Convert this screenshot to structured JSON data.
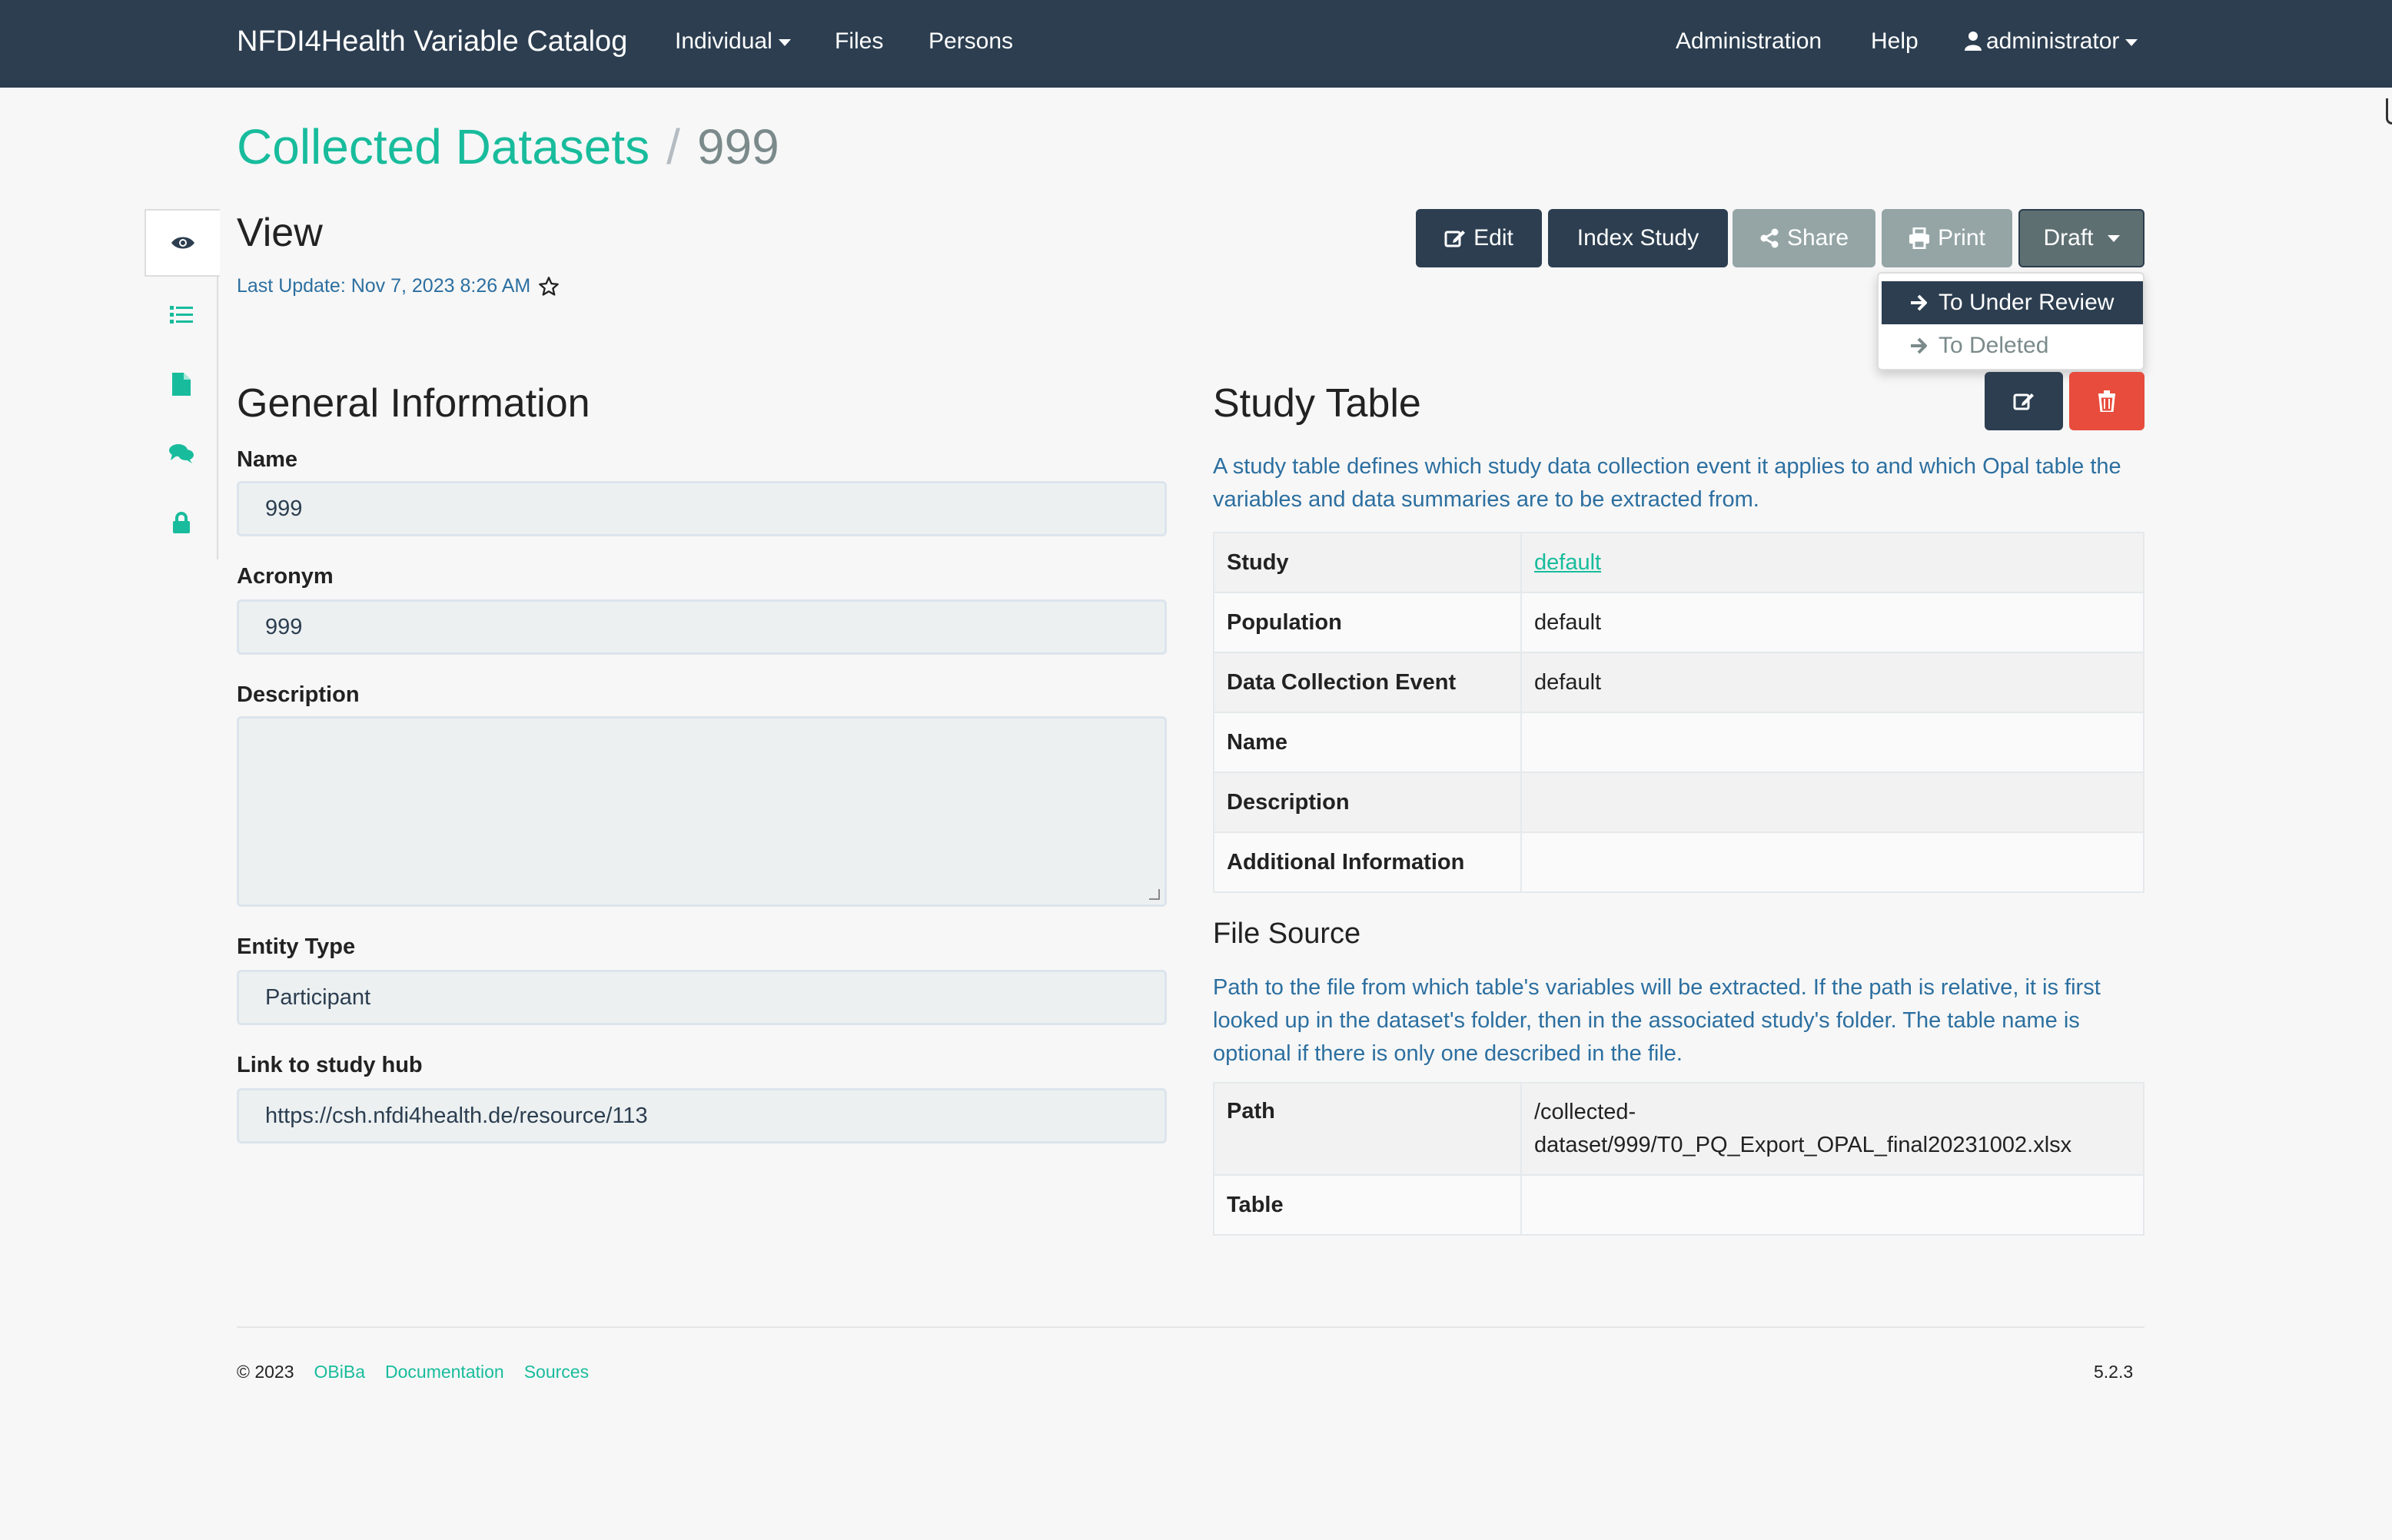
{
  "navbar": {
    "brand": "NFDI4Health Variable Catalog",
    "individual": "Individual",
    "files": "Files",
    "persons": "Persons",
    "administration": "Administration",
    "help": "Help",
    "user": "administrator"
  },
  "breadcrumb": {
    "section": "Collected Datasets",
    "separator": "/",
    "current": "999"
  },
  "view": {
    "title": "View",
    "last_update": "Last Update: Nov 7, 2023 8:26 AM"
  },
  "toolbar": {
    "edit": "Edit",
    "index_study": "Index Study",
    "share": "Share",
    "print": "Print",
    "draft": "Draft"
  },
  "status_menu": {
    "to_under_review": "To Under Review",
    "to_deleted": "To Deleted"
  },
  "general": {
    "title": "General Information",
    "name_label": "Name",
    "name_value": "999",
    "acronym_label": "Acronym",
    "acronym_value": "999",
    "description_label": "Description",
    "description_value": "",
    "entity_type_label": "Entity Type",
    "entity_type_value": "Participant",
    "study_hub_label": "Link to study hub",
    "study_hub_value": "https://csh.nfdi4health.de/resource/113"
  },
  "study_table": {
    "title": "Study Table",
    "help": "A study table defines which study data collection event it applies to and which Opal table the variables and data summaries are to be extracted from.",
    "rows": [
      {
        "key": "Study",
        "value": "default"
      },
      {
        "key": "Population",
        "value": "default"
      },
      {
        "key": "Data Collection Event",
        "value": "default"
      },
      {
        "key": "Name",
        "value": ""
      },
      {
        "key": "Description",
        "value": ""
      },
      {
        "key": "Additional Information",
        "value": ""
      }
    ]
  },
  "file_source": {
    "title": "File Source",
    "help": "Path to the file from which table's variables will be extracted. If the path is relative, it is first looked up in the dataset's folder, then in the associated study's folder. The table name is optional if there is only one described in the file.",
    "path_label": "Path",
    "path_line1": "/collected-",
    "path_line2": "dataset/999/T0_PQ_Export_OPAL_final20231002.xlsx",
    "table_label": "Table",
    "table_value": ""
  },
  "footer": {
    "copyright": "© 2023",
    "obiba": "OBiBa",
    "documentation": "Documentation",
    "sources": "Sources",
    "version": "5.2.3"
  },
  "colors": {
    "navbar": "#2c3e50",
    "accent": "#18bc9c",
    "danger": "#e74c3c",
    "muted_button": "#95a5a6",
    "help_text": "#2c6fa0"
  },
  "icons": [
    "eye-icon",
    "list-icon",
    "file-icon",
    "comments-icon",
    "lock-icon",
    "edit-icon",
    "share-icon",
    "print-icon",
    "arrow-right-icon",
    "trash-icon",
    "star-icon",
    "user-icon"
  ]
}
